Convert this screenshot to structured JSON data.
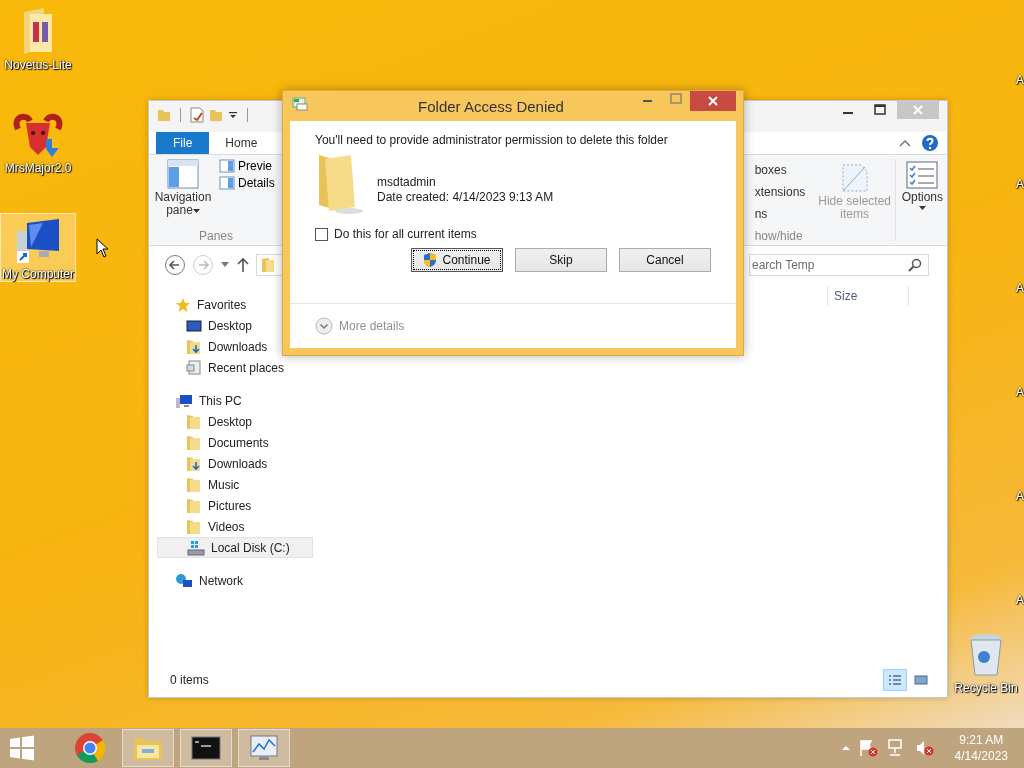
{
  "desktop_icons": [
    {
      "label": "Novetus-Lite",
      "kind": "folder",
      "selected": false
    },
    {
      "label": "MrsMajor2.0",
      "kind": "ram",
      "selected": false
    },
    {
      "label": "My Computer",
      "kind": "computer",
      "selected": true
    },
    {
      "label": "Recycle Bin",
      "kind": "recycle",
      "selected": false
    }
  ],
  "edge_labels": [
    "A",
    "A",
    "A",
    "A",
    "A",
    "A"
  ],
  "explorer": {
    "tabs": [
      {
        "label": "File",
        "kind": "file"
      },
      {
        "label": "Home",
        "kind": "tab"
      }
    ],
    "ribbon": {
      "navigation_pane": "Navigation pane",
      "panes": {
        "items": [
          "Previe",
          "Details"
        ],
        "label": "Panes"
      },
      "show_hide": {
        "items": [
          "boxes",
          "xtensions",
          "ns"
        ],
        "label": "how/hide"
      },
      "hide_selected": {
        "label": "Hide selected items",
        "disabled": true
      },
      "options": "Options"
    },
    "search": {
      "placeholder": "earch Temp"
    },
    "columns": [
      "Size"
    ],
    "nav": [
      {
        "label": "Favorites",
        "kind": "star",
        "selected": false,
        "children": [
          {
            "label": "Desktop",
            "kind": "desktop",
            "selected": false
          },
          {
            "label": "Downloads",
            "kind": "downloads",
            "selected": false
          },
          {
            "label": "Recent places",
            "kind": "recent",
            "selected": false
          }
        ]
      },
      {
        "label": "This PC",
        "kind": "pc",
        "selected": false,
        "children": [
          {
            "label": "Desktop",
            "kind": "folder",
            "selected": false
          },
          {
            "label": "Documents",
            "kind": "folder",
            "selected": false
          },
          {
            "label": "Downloads",
            "kind": "downloads",
            "selected": false
          },
          {
            "label": "Music",
            "kind": "folder",
            "selected": false
          },
          {
            "label": "Pictures",
            "kind": "folder",
            "selected": false
          },
          {
            "label": "Videos",
            "kind": "folder",
            "selected": false
          },
          {
            "label": "Local Disk (C:)",
            "kind": "disk",
            "selected": true
          }
        ]
      },
      {
        "label": "Network",
        "kind": "network",
        "selected": false
      }
    ],
    "status": "0 items",
    "view_buttons": [
      {
        "kind": "details",
        "selected": true
      },
      {
        "kind": "large-icons",
        "selected": false
      }
    ]
  },
  "dialog": {
    "title": "Folder Access Denied",
    "message": "You'll need to provide administrator permission to delete this folder",
    "item_name": "msdtadmin",
    "item_date": "Date created: 4/14/2023 9:13 AM",
    "checkbox": {
      "label": "Do this for all current items",
      "checked": false
    },
    "buttons": [
      {
        "label": "Continue",
        "shield": true,
        "focused": true
      },
      {
        "label": "Skip",
        "shield": false,
        "focused": false
      },
      {
        "label": "Cancel",
        "shield": false,
        "focused": false
      }
    ],
    "more_details": {
      "label": "More details",
      "disabled": true
    }
  },
  "taskbar": {
    "apps": [
      {
        "kind": "browser",
        "running": false
      },
      {
        "kind": "explorer",
        "running": true
      },
      {
        "kind": "console",
        "running": true
      },
      {
        "kind": "monitor",
        "running": true
      }
    ],
    "clock": {
      "time": "9:21 AM",
      "date": "4/14/2023"
    }
  }
}
